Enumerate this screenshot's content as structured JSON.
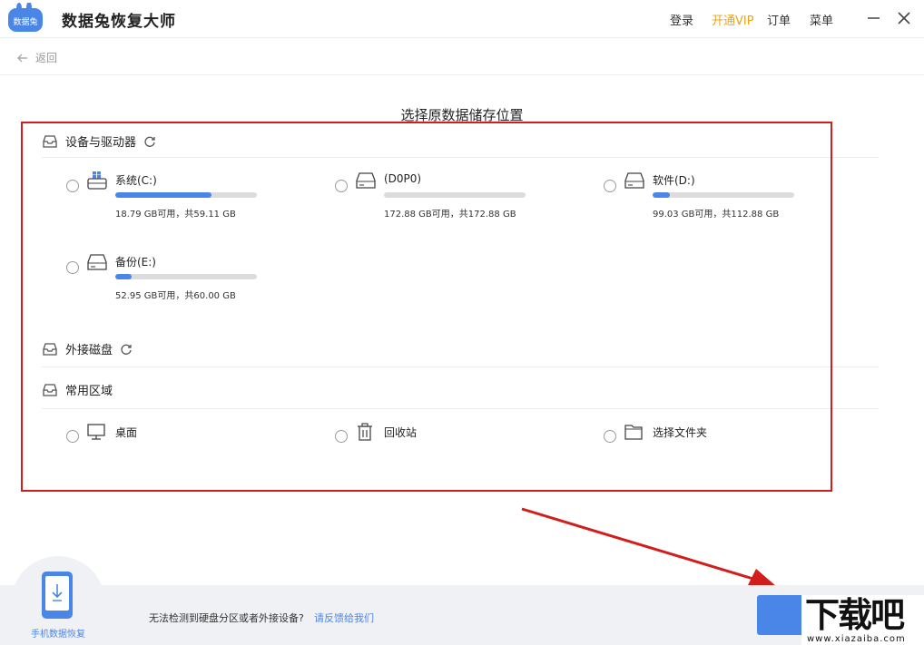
{
  "app": {
    "title": "数据兔恢复大师",
    "logo_text": "数据兔",
    "brand_color": "#4a86e8",
    "vip_color": "#e8a417"
  },
  "top_menu": {
    "login": "登录",
    "vip": "开通VIP",
    "orders": "订单",
    "menu": "菜单"
  },
  "nav": {
    "back": "返回"
  },
  "page_title": "选择原数据储存位置",
  "sections": {
    "devices": "设备与驱动器",
    "external": "外接磁盘",
    "common": "常用区域"
  },
  "drives": [
    {
      "name": "系统(C:)",
      "info": "18.79 GB可用，共59.11 GB",
      "used_fraction": 0.682,
      "icon": "windows-drive-icon"
    },
    {
      "name": "(D0P0)",
      "info": "172.88 GB可用，共172.88 GB",
      "used_fraction": 0.0,
      "icon": "hard-drive-icon"
    },
    {
      "name": "软件(D:)",
      "info": "99.03 GB可用，共112.88 GB",
      "used_fraction": 0.123,
      "icon": "hard-drive-icon"
    },
    {
      "name": "备份(E:)",
      "info": "52.95 GB可用，共60.00 GB",
      "used_fraction": 0.118,
      "icon": "hard-drive-icon"
    }
  ],
  "common_areas": [
    {
      "name": "桌面",
      "icon": "desktop-icon"
    },
    {
      "name": "回收站",
      "icon": "recycle-bin-icon"
    },
    {
      "name": "选择文件夹",
      "icon": "folder-icon"
    }
  ],
  "bottom": {
    "phone_recovery": "手机数据恢复",
    "hint": "无法检测到硬盘分区或者外接设备?",
    "feedback": "请反馈给我们"
  },
  "watermark": {
    "big": "下载吧",
    "small": "www.xiazaiba.com"
  }
}
